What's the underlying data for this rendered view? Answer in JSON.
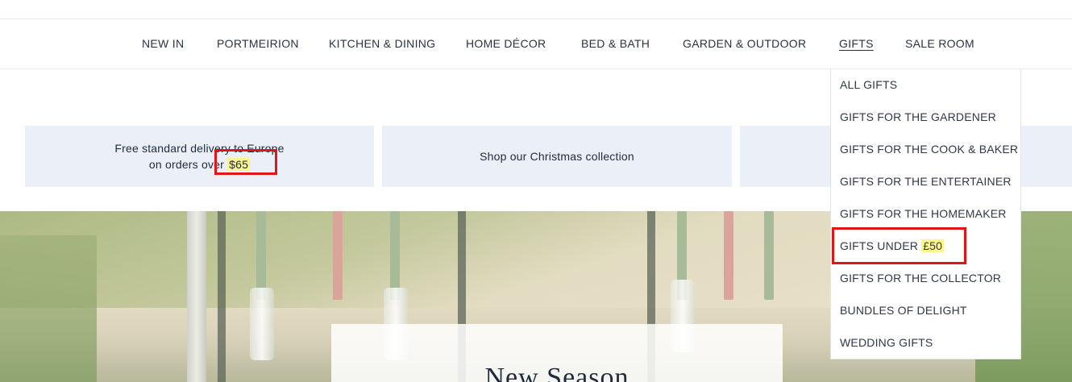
{
  "nav": {
    "items": [
      {
        "label": "NEW IN"
      },
      {
        "label": "PORTMEIRION"
      },
      {
        "label": "KITCHEN & DINING"
      },
      {
        "label": "HOME DÉCOR"
      },
      {
        "label": "BED & BATH"
      },
      {
        "label": "GARDEN & OUTDOOR"
      },
      {
        "label": "GIFTS"
      },
      {
        "label": "SALE ROOM"
      }
    ],
    "active": "GIFTS"
  },
  "promos": {
    "delivery_line1": "Free standard delivery to Europe",
    "delivery_line2_prefix": "on orders over ",
    "delivery_amount": "$65",
    "christmas": "Shop our Christmas collection"
  },
  "gifts_menu": {
    "items": [
      {
        "label": "ALL GIFTS"
      },
      {
        "label": "GIFTS FOR THE GARDENER"
      },
      {
        "label": "GIFTS FOR THE COOK & BAKER"
      },
      {
        "label": "GIFTS FOR THE ENTERTAINER"
      },
      {
        "label": "GIFTS FOR THE HOMEMAKER"
      },
      {
        "label": "GIFTS UNDER ",
        "amount": "£50"
      },
      {
        "label": "GIFTS FOR THE COLLECTOR"
      },
      {
        "label": "BUNDLES OF DELIGHT"
      },
      {
        "label": "WEDDING GIFTS"
      }
    ]
  },
  "hero": {
    "title": "New Season"
  },
  "colors": {
    "promo_bg": "#eaeff8",
    "text": "#1f2b3d",
    "highlight": "#fbf58a",
    "annotation_box": "#e01515"
  }
}
